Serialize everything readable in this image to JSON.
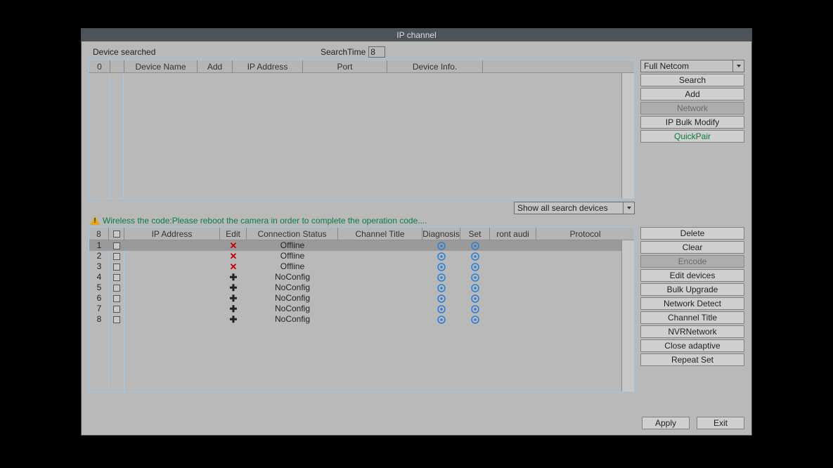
{
  "window": {
    "title": "IP channel"
  },
  "top": {
    "device_searched": "Device searched",
    "search_time_label": "SearchTime",
    "search_time_value": "8",
    "columns": {
      "count": "0",
      "chk": "",
      "device_name": "Device Name",
      "add": "Add",
      "ip": "IP Address",
      "port": "Port",
      "info": "Device Info."
    }
  },
  "side1": {
    "select": "Full Netcom",
    "search": "Search",
    "add": "Add",
    "network": "Network",
    "ipbulk": "IP Bulk Modify",
    "quickpair": "QuickPair"
  },
  "show_all": "Show all search devices",
  "warning": "Wireless the code:Please reboot the camera in order to complete the operation code....",
  "channels": {
    "count": "8",
    "columns": {
      "ip": "IP Address",
      "edit": "Edit",
      "conn": "Connection Status",
      "title": "Channel Title",
      "diag": "Diagnosis",
      "set": "Set",
      "front": "ront audi",
      "proto": "Protocol"
    },
    "rows": [
      {
        "n": "1",
        "edit": "x",
        "status": "Offline",
        "gear": true,
        "sel": true
      },
      {
        "n": "2",
        "edit": "x",
        "status": "Offline",
        "gear": true
      },
      {
        "n": "3",
        "edit": "x",
        "status": "Offline",
        "gear": true
      },
      {
        "n": "4",
        "edit": "+",
        "status": "NoConfig",
        "gear": true
      },
      {
        "n": "5",
        "edit": "+",
        "status": "NoConfig",
        "gear": true
      },
      {
        "n": "6",
        "edit": "+",
        "status": "NoConfig",
        "gear": true
      },
      {
        "n": "7",
        "edit": "+",
        "status": "NoConfig",
        "gear": true
      },
      {
        "n": "8",
        "edit": "+",
        "status": "NoConfig",
        "gear": true
      }
    ]
  },
  "side2": {
    "delete": "Delete",
    "clear": "Clear",
    "encode": "Encode",
    "edit_devices": "Edit devices",
    "bulk_upgrade": "Bulk Upgrade",
    "net_detect": "Network Detect",
    "ch_title": "Channel Title",
    "nvr_net": "NVRNetwork",
    "close_adapt": "Close adaptive",
    "repeat_set": "Repeat Set"
  },
  "bottom": {
    "apply": "Apply",
    "exit": "Exit"
  }
}
